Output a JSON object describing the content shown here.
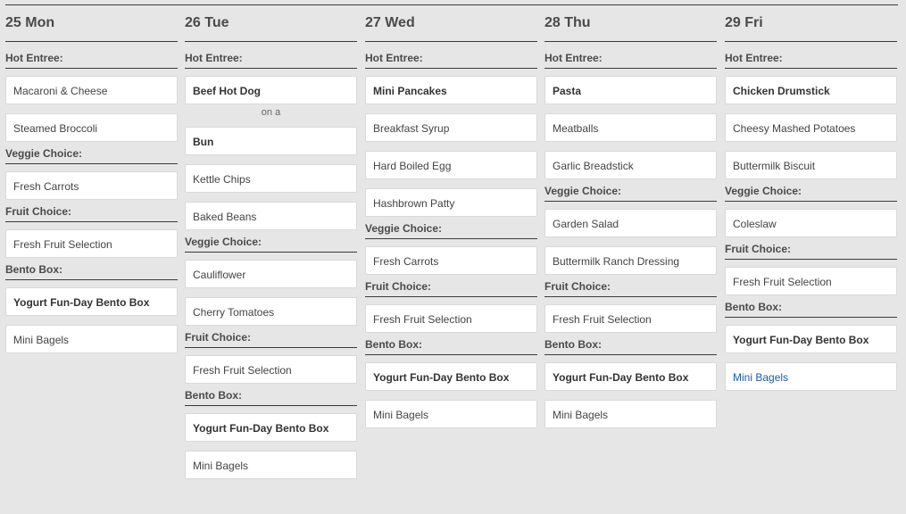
{
  "days": [
    {
      "header": "25 Mon",
      "sections": [
        {
          "label": "Hot Entree:",
          "items": [
            {
              "text": "Macaroni & Cheese",
              "bold": false
            },
            {
              "text": "Steamed Broccoli",
              "bold": false
            }
          ]
        },
        {
          "label": "Veggie Choice:",
          "items": [
            {
              "text": "Fresh Carrots",
              "bold": false
            }
          ]
        },
        {
          "label": "Fruit Choice:",
          "items": [
            {
              "text": "Fresh Fruit Selection",
              "bold": false
            }
          ]
        },
        {
          "label": "Bento Box:",
          "items": [
            {
              "text": "Yogurt Fun-Day Bento Box",
              "bold": true
            },
            {
              "text": "Mini Bagels",
              "bold": false
            }
          ]
        }
      ]
    },
    {
      "header": "26 Tue",
      "sections": [
        {
          "label": "Hot Entree:",
          "items": [
            {
              "text": "Beef Hot Dog",
              "bold": true
            },
            {
              "connector": "on a"
            },
            {
              "text": "Bun",
              "bold": true
            },
            {
              "text": "Kettle Chips",
              "bold": false
            },
            {
              "text": "Baked Beans",
              "bold": false
            }
          ]
        },
        {
          "label": "Veggie Choice:",
          "items": [
            {
              "text": "Cauliflower",
              "bold": false
            },
            {
              "text": "Cherry Tomatoes",
              "bold": false
            }
          ]
        },
        {
          "label": "Fruit Choice:",
          "items": [
            {
              "text": "Fresh Fruit Selection",
              "bold": false
            }
          ]
        },
        {
          "label": "Bento Box:",
          "items": [
            {
              "text": "Yogurt Fun-Day Bento Box",
              "bold": true
            },
            {
              "text": "Mini Bagels",
              "bold": false
            }
          ]
        }
      ]
    },
    {
      "header": "27 Wed",
      "sections": [
        {
          "label": "Hot Entree:",
          "items": [
            {
              "text": "Mini Pancakes",
              "bold": true
            },
            {
              "text": "Breakfast Syrup",
              "bold": false
            },
            {
              "text": "Hard Boiled Egg",
              "bold": false
            },
            {
              "text": "Hashbrown Patty",
              "bold": false
            }
          ]
        },
        {
          "label": "Veggie Choice:",
          "items": [
            {
              "text": "Fresh Carrots",
              "bold": false
            }
          ]
        },
        {
          "label": "Fruit Choice:",
          "items": [
            {
              "text": "Fresh Fruit Selection",
              "bold": false
            }
          ]
        },
        {
          "label": "Bento Box:",
          "items": [
            {
              "text": "Yogurt Fun-Day Bento Box",
              "bold": true
            },
            {
              "text": "Mini Bagels",
              "bold": false
            }
          ]
        }
      ]
    },
    {
      "header": "28 Thu",
      "sections": [
        {
          "label": "Hot Entree:",
          "items": [
            {
              "text": "Pasta",
              "bold": true
            },
            {
              "text": "Meatballs",
              "bold": false
            },
            {
              "text": "Garlic Breadstick",
              "bold": false
            }
          ]
        },
        {
          "label": "Veggie Choice:",
          "items": [
            {
              "text": "Garden Salad",
              "bold": false
            },
            {
              "text": "Buttermilk Ranch Dressing",
              "bold": false
            }
          ]
        },
        {
          "label": "Fruit Choice:",
          "items": [
            {
              "text": "Fresh Fruit Selection",
              "bold": false
            }
          ]
        },
        {
          "label": "Bento Box:",
          "items": [
            {
              "text": "Yogurt Fun-Day Bento Box",
              "bold": true
            },
            {
              "text": "Mini Bagels",
              "bold": false
            }
          ]
        }
      ]
    },
    {
      "header": "29 Fri",
      "sections": [
        {
          "label": "Hot Entree:",
          "items": [
            {
              "text": "Chicken Drumstick",
              "bold": true
            },
            {
              "text": "Cheesy Mashed Potatoes",
              "bold": false
            },
            {
              "text": "Buttermilk Biscuit",
              "bold": false
            }
          ]
        },
        {
          "label": "Veggie Choice:",
          "items": [
            {
              "text": "Coleslaw",
              "bold": false
            }
          ]
        },
        {
          "label": "Fruit Choice:",
          "items": [
            {
              "text": "Fresh Fruit Selection",
              "bold": false
            }
          ]
        },
        {
          "label": "Bento Box:",
          "items": [
            {
              "text": "Yogurt Fun-Day Bento Box",
              "bold": true
            },
            {
              "text": "Mini Bagels",
              "bold": false,
              "link": true
            }
          ]
        }
      ]
    }
  ]
}
